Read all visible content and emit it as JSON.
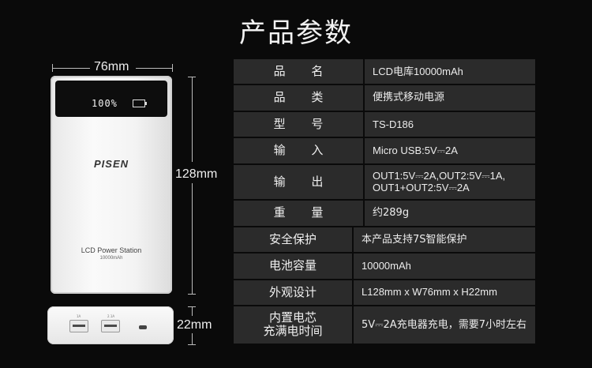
{
  "title": "产品参数",
  "dimensions": {
    "width": "76mm",
    "height": "128mm",
    "depth": "22mm"
  },
  "product": {
    "lcd_readout": "100%",
    "brand": "PISEN",
    "model_text": "LCD Power Station",
    "capacity_text": "10000mAh"
  },
  "specs": [
    {
      "key": "品 名",
      "value": "LCD电库10000mAh"
    },
    {
      "key": "品 类",
      "value": "便携式移动电源"
    },
    {
      "key": "型 号",
      "value": "TS-D186"
    },
    {
      "key": "输 入",
      "value": "Micro USB:5V⎓2A"
    },
    {
      "key": "输 出",
      "value": "OUT1:5V⎓2A,OUT2:5V⎓1A,\nOUT1+OUT2:5V⎓2A"
    },
    {
      "key": "重 量",
      "value": "约289g"
    },
    {
      "key": "安全保护",
      "value": "本产品支持7S智能保护"
    },
    {
      "key": "电池容量",
      "value": "10000mAh"
    },
    {
      "key": "外观设计",
      "value": "L128mm x W76mm x H22mm"
    },
    {
      "key": "内置电芯\n充满电时间",
      "value": "5V⎓2A充电器充电，需要7小时左右"
    }
  ]
}
